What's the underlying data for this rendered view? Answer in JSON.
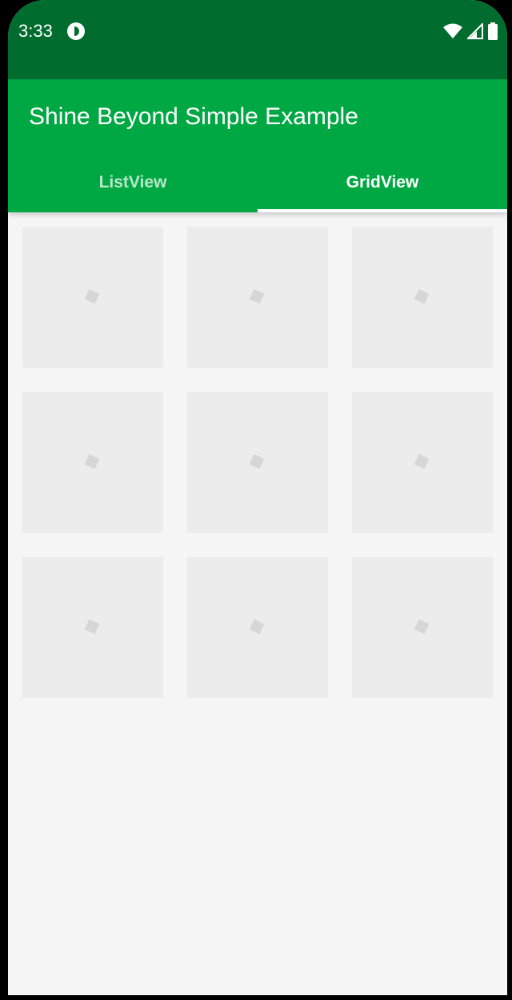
{
  "status_bar": {
    "time": "3:33",
    "icons": [
      "app-notification-icon",
      "wifi-icon",
      "signal-icon",
      "battery-icon"
    ]
  },
  "app_bar": {
    "title": "Shine Beyond Simple Example",
    "color": "#00a843",
    "status_color": "#006d2f"
  },
  "tabs": [
    {
      "label": "ListView",
      "selected": false
    },
    {
      "label": "GridView",
      "selected": true
    }
  ],
  "grid": {
    "columns": 3,
    "rows": 3,
    "items_state": "loading-placeholder"
  }
}
